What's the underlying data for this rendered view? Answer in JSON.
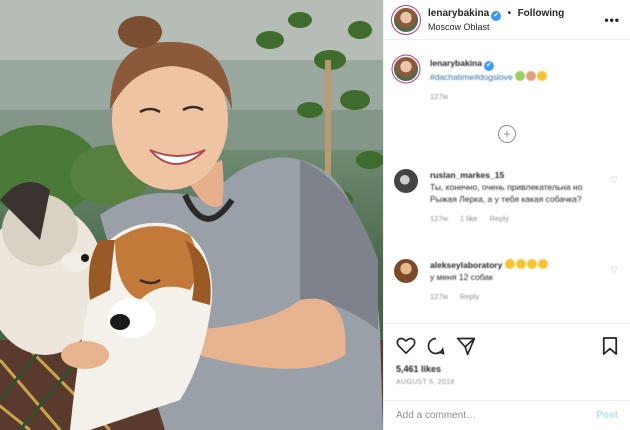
{
  "header": {
    "username": "lenarybakina",
    "verified_glyph": "✔",
    "separator": "•",
    "follow_label": "Following",
    "location": "Moscow Oblast",
    "more_label": "•••"
  },
  "caption": {
    "username": "lenarybakina",
    "text": "#dachatime#dogslove",
    "time": "127w"
  },
  "load_more_label": "+",
  "comments": [
    {
      "username": "ruslan_markes_15",
      "text": "Ты, конечно, очень привлекательна но Рыжая Лерка, а у тебя какая собачка?",
      "time": "127w",
      "likes": "1 like",
      "reply": "Reply"
    },
    {
      "username": "alekseylaboratory",
      "text": "у меня 12 собак",
      "time": "127w",
      "reply": "Reply"
    }
  ],
  "actions": {
    "likes": "5,461 likes",
    "date": "AUGUST 5, 2018"
  },
  "add_comment": {
    "placeholder": "Add a comment…",
    "post_label": "Post"
  },
  "colors": {
    "link": "#3897f0",
    "post_disabled": "#b2dffc",
    "muted": "#8e8e8e"
  }
}
